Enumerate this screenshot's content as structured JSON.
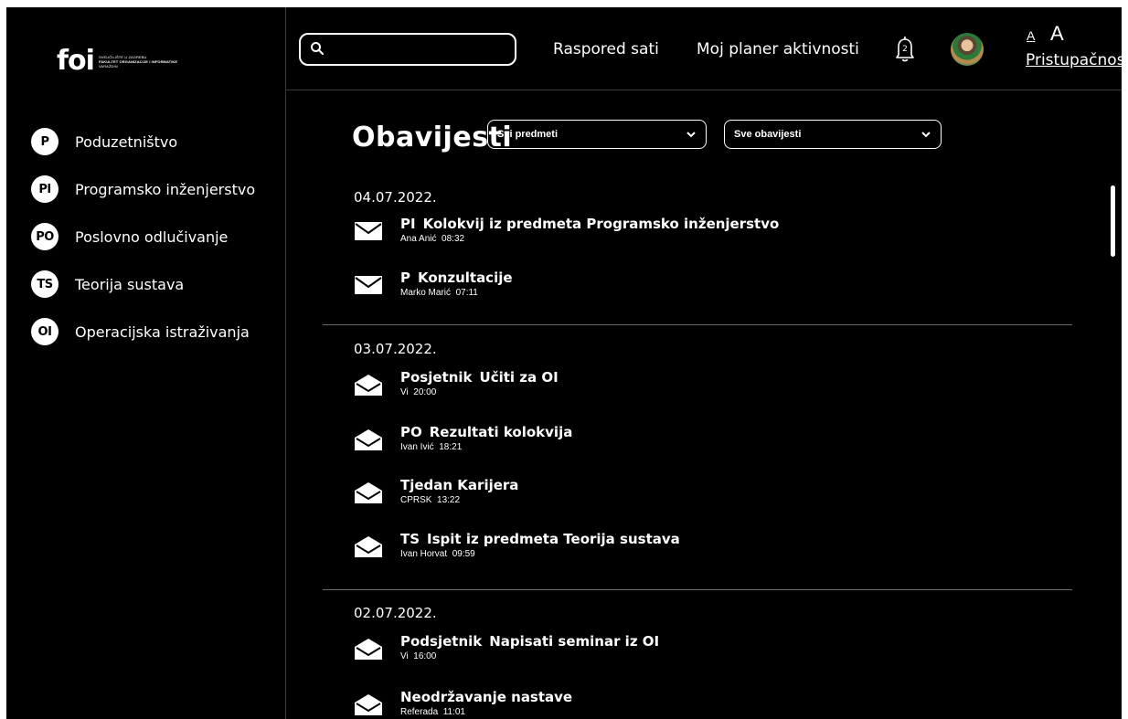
{
  "colors": {
    "background": "#000000",
    "foreground": "#ffffff",
    "divider": "#6a6a6a"
  },
  "logo": {
    "mark": "foi",
    "lines": [
      "SVEUČILIŠTE U ZAGREBU",
      "FAKULTET ORGANIZACIJE I INFORMATIKE",
      "VARAŽDIN"
    ]
  },
  "sidebar": {
    "courses": [
      {
        "badge": "P",
        "name": "Poduzetništvo"
      },
      {
        "badge": "PI",
        "name": "Programsko inženjerstvo"
      },
      {
        "badge": "PO",
        "name": "Poslovno odlučivanje"
      },
      {
        "badge": "TS",
        "name": "Teorija sustava"
      },
      {
        "badge": "OI",
        "name": "Operacijska istraživanja"
      }
    ]
  },
  "header": {
    "search": {
      "value": "",
      "icon": "search-icon"
    },
    "nav": {
      "schedule": "Raspored sati",
      "planner": "Moj planer aktivnosti"
    },
    "notifications": {
      "icon": "bell-icon",
      "count": "2"
    },
    "avatar": "user-avatar",
    "accessibility": {
      "small_a": "A",
      "large_a": "A",
      "label": "Pristupačnost"
    }
  },
  "main": {
    "title": "Obavijesti",
    "filters": {
      "subjects": "Svi predmeti",
      "notifications": "Sve obavijesti"
    },
    "groups": [
      {
        "date": "04.07.2022.",
        "items": [
          {
            "tag": "PI",
            "title": "Kolokvij iz predmeta Programsko inženjerstvo",
            "author": "Ana Anić",
            "time": "08:32",
            "read": false
          },
          {
            "tag": "P",
            "title": "Konzultacije",
            "author": "Marko Marić",
            "time": "07:11",
            "read": false
          }
        ]
      },
      {
        "date": "03.07.2022.",
        "items": [
          {
            "tag": "Posjetnik",
            "title": "Učiti za OI",
            "author": "Vi",
            "time": "20:00",
            "read": true
          },
          {
            "tag": "PO",
            "title": "Rezultati kolokvija",
            "author": "Ivan Ivić",
            "time": "18:21",
            "read": true
          },
          {
            "tag": "",
            "title": "Tjedan Karijera",
            "author": "CPRSK",
            "time": "13:22",
            "read": true
          },
          {
            "tag": "TS",
            "title": "Ispit iz predmeta Teorija sustava",
            "author": "Ivan Horvat",
            "time": "09:59",
            "read": true
          }
        ]
      },
      {
        "date": "02.07.2022.",
        "items": [
          {
            "tag": "Podsjetnik",
            "title": "Napisati seminar iz OI",
            "author": "Vi",
            "time": "16:00",
            "read": true
          },
          {
            "tag": "",
            "title": "Neodržavanje nastave",
            "author": "Referada",
            "time": "11:01",
            "read": true
          }
        ]
      }
    ]
  }
}
